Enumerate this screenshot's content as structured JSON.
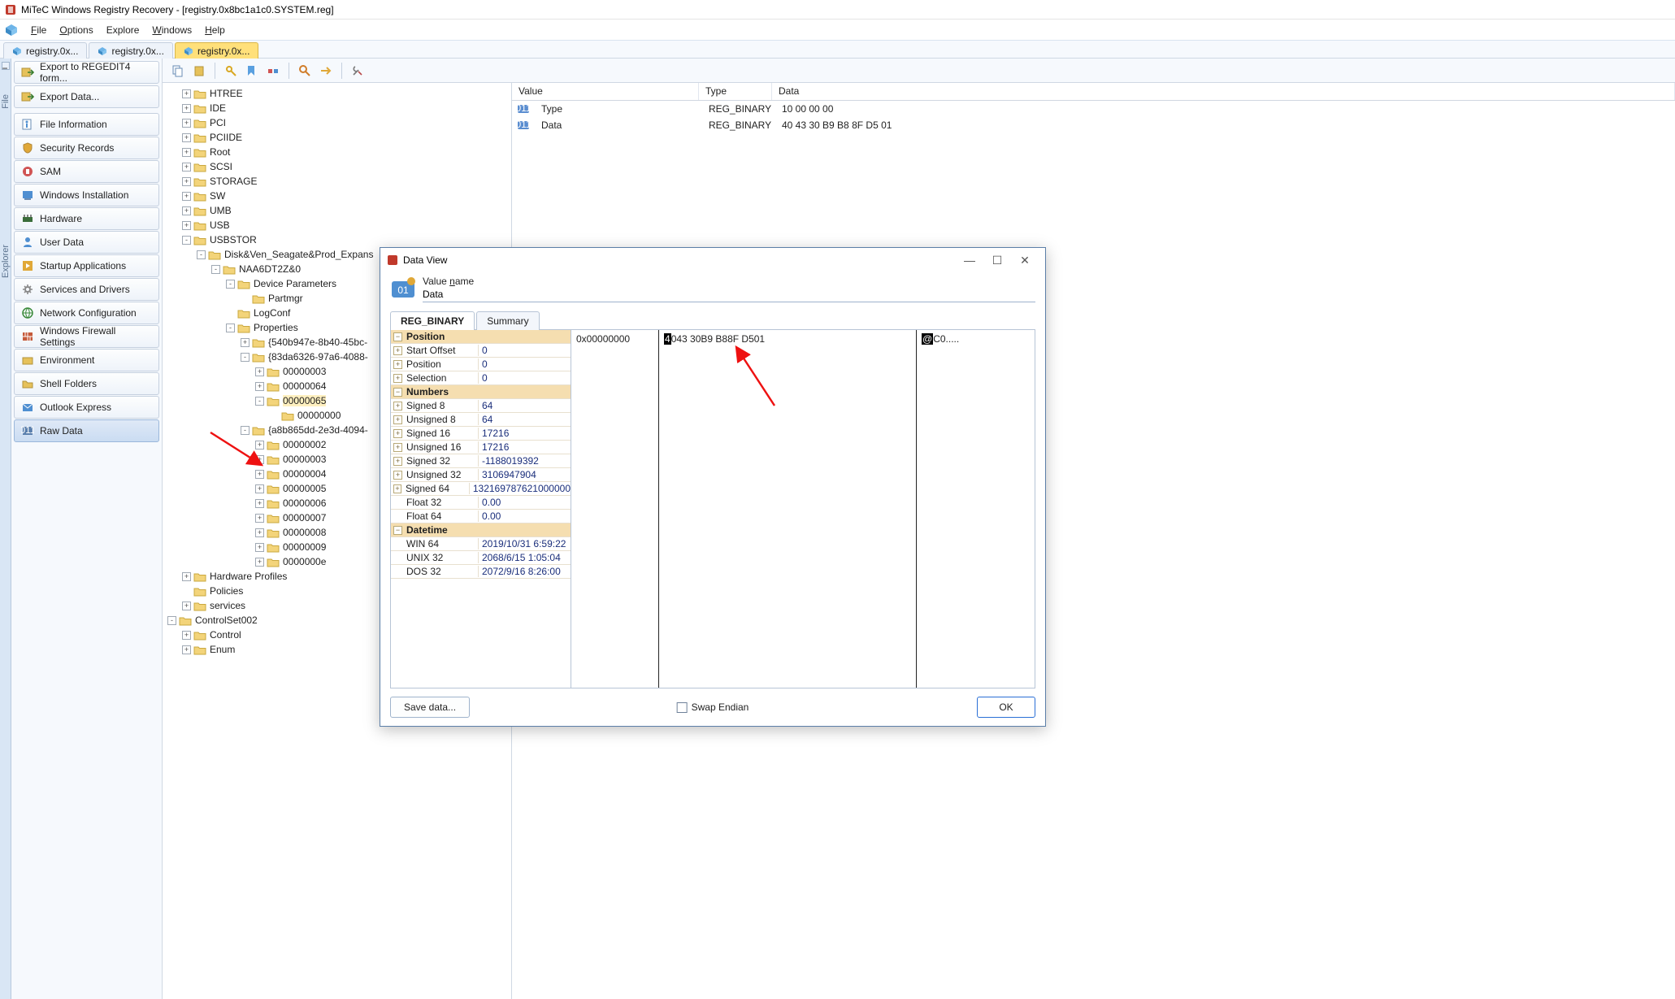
{
  "window": {
    "title": "MiTeC Windows Registry Recovery - [registry.0x8bc1a1c0.SYSTEM.reg]"
  },
  "menus": {
    "file": "File",
    "options": "Options",
    "explore": "Explore",
    "windows": "Windows",
    "help": "Help"
  },
  "filetabs": [
    {
      "label": "registry.0x...",
      "active": false
    },
    {
      "label": "registry.0x...",
      "active": false
    },
    {
      "label": "registry.0x...",
      "active": true
    }
  ],
  "explorer_label": "Explorer",
  "file_label": "File",
  "sidebar": {
    "export4": "Export to REGEDIT4 form...",
    "exportdata": "Export Data...",
    "items": [
      {
        "label": "File Information",
        "icon": "file-info-icon"
      },
      {
        "label": "Security Records",
        "icon": "shield-icon"
      },
      {
        "label": "SAM",
        "icon": "sam-icon"
      },
      {
        "label": "Windows Installation",
        "icon": "win-install-icon"
      },
      {
        "label": "Hardware",
        "icon": "hardware-icon"
      },
      {
        "label": "User Data",
        "icon": "user-icon"
      },
      {
        "label": "Startup Applications",
        "icon": "startup-icon"
      },
      {
        "label": "Services and Drivers",
        "icon": "gear-icon"
      },
      {
        "label": "Network Configuration",
        "icon": "network-icon"
      },
      {
        "label": "Windows Firewall Settings",
        "icon": "firewall-icon"
      },
      {
        "label": "Environment",
        "icon": "env-icon"
      },
      {
        "label": "Shell Folders",
        "icon": "folder-icon"
      },
      {
        "label": "Outlook Express",
        "icon": "outlook-icon"
      },
      {
        "label": "Raw Data",
        "icon": "raw-icon",
        "selected": true
      }
    ]
  },
  "tree": [
    {
      "d": 1,
      "e": "+",
      "label": "HTREE"
    },
    {
      "d": 1,
      "e": "+",
      "label": "IDE"
    },
    {
      "d": 1,
      "e": "+",
      "label": "PCI"
    },
    {
      "d": 1,
      "e": "+",
      "label": "PCIIDE"
    },
    {
      "d": 1,
      "e": "+",
      "label": "Root"
    },
    {
      "d": 1,
      "e": "+",
      "label": "SCSI"
    },
    {
      "d": 1,
      "e": "+",
      "label": "STORAGE"
    },
    {
      "d": 1,
      "e": "+",
      "label": "SW"
    },
    {
      "d": 1,
      "e": "+",
      "label": "UMB"
    },
    {
      "d": 1,
      "e": "+",
      "label": "USB"
    },
    {
      "d": 1,
      "e": "-",
      "label": "USBSTOR"
    },
    {
      "d": 2,
      "e": "-",
      "label": "Disk&Ven_Seagate&Prod_Expans"
    },
    {
      "d": 3,
      "e": "-",
      "label": "NAA6DT2Z&0"
    },
    {
      "d": 4,
      "e": "-",
      "label": "Device Parameters"
    },
    {
      "d": 5,
      "e": "",
      "label": "Partmgr"
    },
    {
      "d": 4,
      "e": "",
      "label": "LogConf"
    },
    {
      "d": 4,
      "e": "-",
      "label": "Properties"
    },
    {
      "d": 5,
      "e": "+",
      "label": "{540b947e-8b40-45bc-"
    },
    {
      "d": 5,
      "e": "-",
      "label": "{83da6326-97a6-4088-"
    },
    {
      "d": 6,
      "e": "+",
      "label": "00000003"
    },
    {
      "d": 6,
      "e": "+",
      "label": "00000064"
    },
    {
      "d": 6,
      "e": "-",
      "label": "00000065",
      "sel": true
    },
    {
      "d": 7,
      "e": "",
      "label": "00000000"
    },
    {
      "d": 5,
      "e": "-",
      "label": "{a8b865dd-2e3d-4094-"
    },
    {
      "d": 6,
      "e": "+",
      "label": "00000002"
    },
    {
      "d": 6,
      "e": "+",
      "label": "00000003"
    },
    {
      "d": 6,
      "e": "+",
      "label": "00000004"
    },
    {
      "d": 6,
      "e": "+",
      "label": "00000005"
    },
    {
      "d": 6,
      "e": "+",
      "label": "00000006"
    },
    {
      "d": 6,
      "e": "+",
      "label": "00000007"
    },
    {
      "d": 6,
      "e": "+",
      "label": "00000008"
    },
    {
      "d": 6,
      "e": "+",
      "label": "00000009"
    },
    {
      "d": 6,
      "e": "+",
      "label": "0000000e"
    },
    {
      "d": 1,
      "e": "+",
      "label": "Hardware Profiles"
    },
    {
      "d": 1,
      "e": "",
      "label": "Policies"
    },
    {
      "d": 1,
      "e": "+",
      "label": "services"
    },
    {
      "d": 0,
      "e": "-",
      "label": "ControlSet002"
    },
    {
      "d": 1,
      "e": "+",
      "label": "Control"
    },
    {
      "d": 1,
      "e": "+",
      "label": "Enum"
    }
  ],
  "vallist": {
    "headers": {
      "value": "Value",
      "type": "Type",
      "data": "Data"
    },
    "rows": [
      {
        "name": "Type",
        "type": "REG_BINARY",
        "data": "10 00 00 00"
      },
      {
        "name": "Data",
        "type": "REG_BINARY",
        "data": "40 43 30 B9 B8 8F D5 01"
      }
    ]
  },
  "dataview": {
    "title": "Data View",
    "valuename_label": "Value name",
    "valuename": "Data",
    "tabs": {
      "reg_binary": "REG_BINARY",
      "summary": "Summary"
    },
    "groups": {
      "position": "Position",
      "numbers": "Numbers",
      "datetime": "Datetime"
    },
    "props": {
      "start_offset": {
        "k": "Start Offset",
        "v": "0"
      },
      "position": {
        "k": "Position",
        "v": "0"
      },
      "selection": {
        "k": "Selection",
        "v": "0"
      },
      "signed8": {
        "k": "Signed 8",
        "v": "64"
      },
      "unsigned8": {
        "k": "Unsigned 8",
        "v": "64"
      },
      "signed16": {
        "k": "Signed 16",
        "v": "17216"
      },
      "unsigned16": {
        "k": "Unsigned 16",
        "v": "17216"
      },
      "signed32": {
        "k": "Signed 32",
        "v": "-1188019392"
      },
      "unsigned32": {
        "k": "Unsigned 32",
        "v": "3106947904"
      },
      "signed64": {
        "k": "Signed 64",
        "v": "132169787621000000"
      },
      "float32": {
        "k": "Float 32",
        "v": "0.00"
      },
      "float64": {
        "k": "Float 64",
        "v": "0.00"
      },
      "win64": {
        "k": "WIN 64",
        "v": "2019/10/31 6:59:22"
      },
      "unix32": {
        "k": "UNIX 32",
        "v": "2068/6/15 1:05:04"
      },
      "dos32": {
        "k": "DOS 32",
        "v": "2072/9/16 8:26:00"
      }
    },
    "hex": {
      "offset": "0x00000000",
      "bytes_first": "4",
      "bytes_rest": "043 30B9 B88F D501",
      "ascii_first": "@",
      "ascii_rest": "C0....."
    },
    "footer": {
      "save": "Save data...",
      "swap": "Swap Endian",
      "ok": "OK"
    }
  }
}
